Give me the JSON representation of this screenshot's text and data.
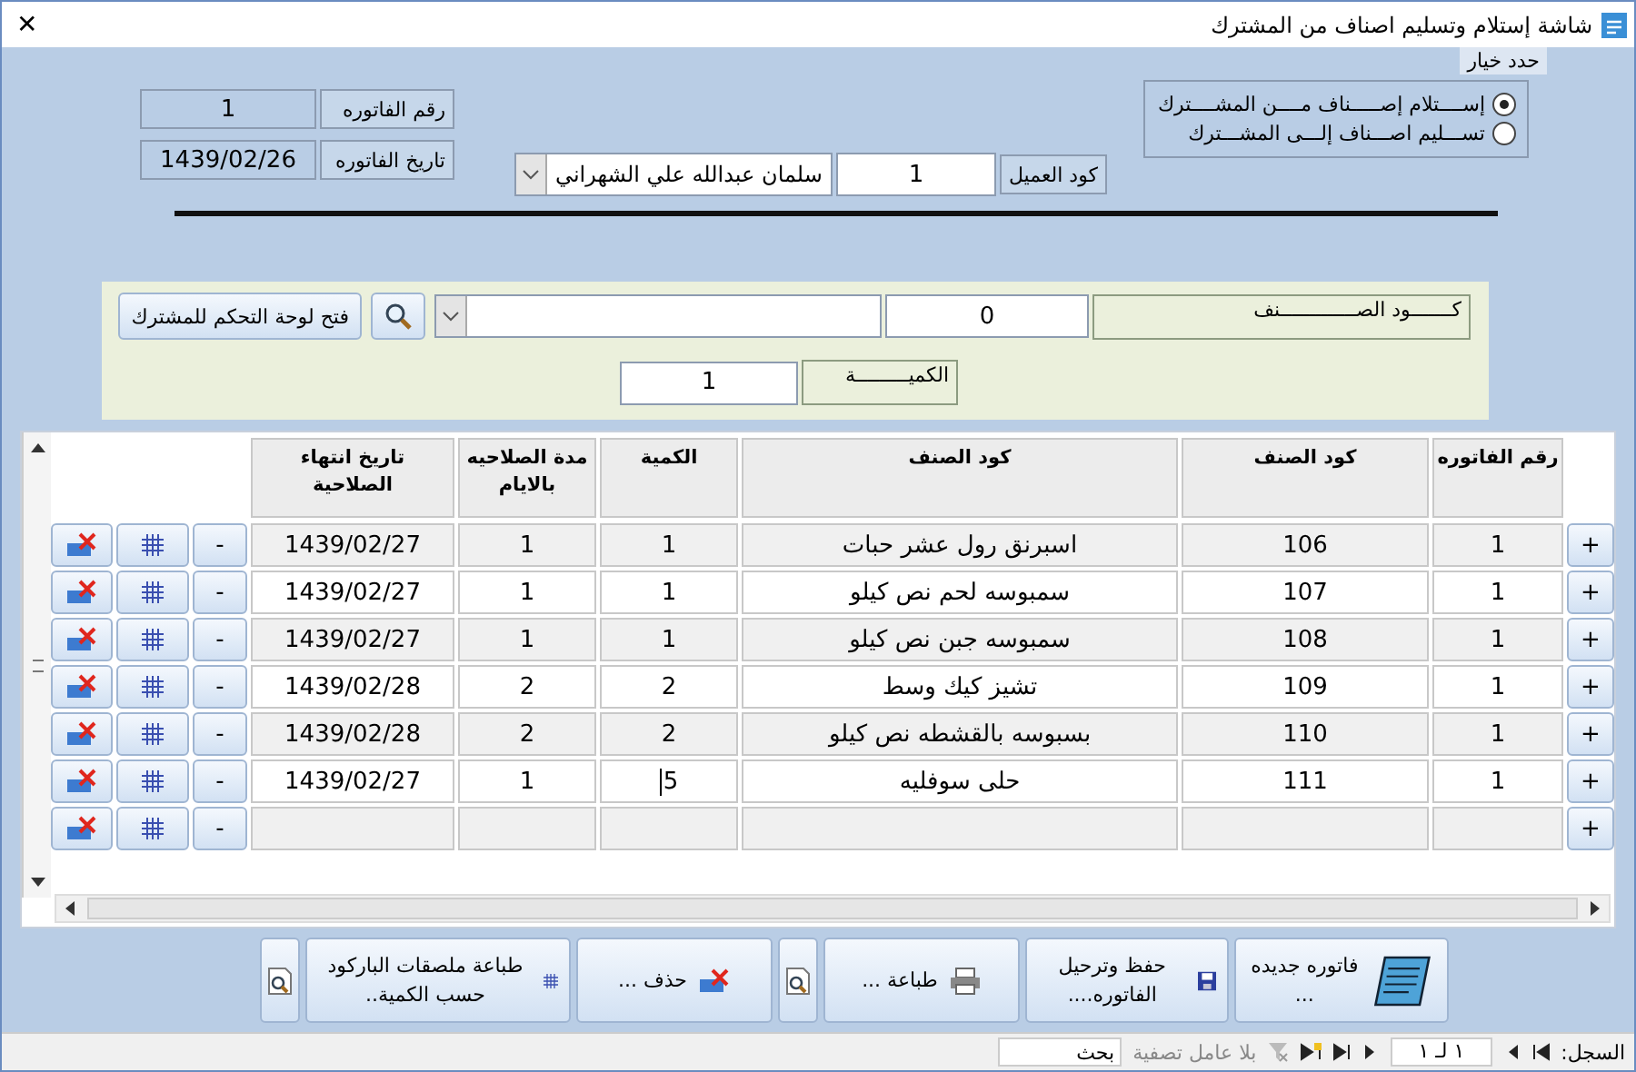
{
  "window": {
    "title": "شاشة إستلام وتسليم اصناف من المشترك",
    "close": "✕"
  },
  "options": {
    "caption": "حدد خيار",
    "items": [
      {
        "label": "إســــتلام إصـــــناف مــــن المشــــترك",
        "selected": true
      },
      {
        "label": "تســـليم اصـــناف إلـــى المشـــترك",
        "selected": false
      }
    ]
  },
  "invoice": {
    "number_label": "رقم الفاتوره",
    "number": "1",
    "date_label": "تاريخ الفاتوره",
    "date": "1439/02/26"
  },
  "customer": {
    "code_label": "كود العميل",
    "code": "1",
    "name": "سلمان عبدالله علي الشهراني"
  },
  "item_entry": {
    "code_label": "كـــــــود الصـــــــــــــنف",
    "code": "0",
    "panel_button": "فتح لوحة التحكم للمشترك",
    "qty_label": "الكميـــــــــة",
    "qty": "1"
  },
  "grid": {
    "columns": [
      "رقم الفاتوره",
      "كود الصنف",
      "كود الصنف",
      "الكمية",
      "مدة الصلاحيه بالايام",
      "تاريخ انتهاء الصلاحية"
    ],
    "rows": [
      {
        "kind": "item",
        "plus": "+",
        "invoice": "1",
        "code": "106",
        "name": "اسبرنق رول عشر حبات",
        "qty": "1",
        "days": "1",
        "expiry": "1439/02/27",
        "minus": "-",
        "editing": false
      },
      {
        "kind": "item",
        "plus": "+",
        "invoice": "1",
        "code": "107",
        "name": "سمبوسه لحم نص كيلو",
        "qty": "1",
        "days": "1",
        "expiry": "1439/02/27",
        "minus": "-",
        "editing": false
      },
      {
        "kind": "item",
        "plus": "+",
        "invoice": "1",
        "code": "108",
        "name": "سمبوسه جبن نص كيلو",
        "qty": "1",
        "days": "1",
        "expiry": "1439/02/27",
        "minus": "-",
        "editing": false
      },
      {
        "kind": "item",
        "plus": "+",
        "invoice": "1",
        "code": "109",
        "name": "تشيز كيك وسط",
        "qty": "2",
        "days": "2",
        "expiry": "1439/02/28",
        "minus": "-",
        "editing": false
      },
      {
        "kind": "item",
        "plus": "+",
        "invoice": "1",
        "code": "110",
        "name": "بسبوسه بالقشطه نص كيلو",
        "qty": "2",
        "days": "2",
        "expiry": "1439/02/28",
        "minus": "-",
        "editing": false
      },
      {
        "kind": "item",
        "plus": "+",
        "invoice": "1",
        "code": "111",
        "name": "حلى سوفليه",
        "qty": "5",
        "days": "1",
        "expiry": "1439/02/27",
        "minus": "-",
        "editing": true
      },
      {
        "kind": "new",
        "plus": "+",
        "minus": "-"
      }
    ]
  },
  "actions": [
    {
      "kind": "new",
      "label": "فاتوره جديده ..."
    },
    {
      "kind": "save",
      "label": "حفظ وترحيل الفاتوره...."
    },
    {
      "kind": "print",
      "label": "طباعة ..."
    },
    {
      "kind": "preview"
    },
    {
      "kind": "delete",
      "label": "حذف ..."
    },
    {
      "kind": "barcode",
      "label": "طباعة ملصقات الباركود حسب الكمية.."
    },
    {
      "kind": "preview"
    }
  ],
  "status_bar": {
    "record_label": "السجل:",
    "record": "١ لـ ١",
    "filter": "بلا عامل تصفية",
    "search_placeholder": "بحث"
  }
}
